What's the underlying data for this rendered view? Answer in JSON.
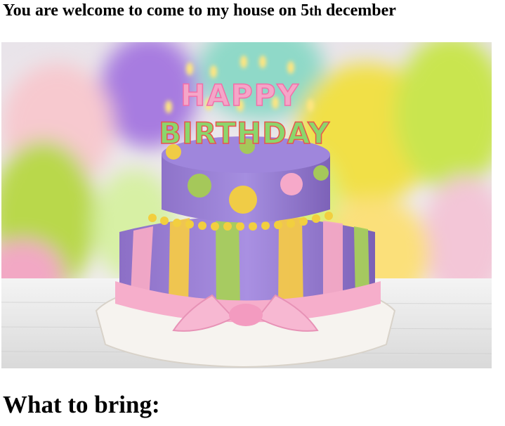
{
  "invitation": {
    "text_before": "You are welcome to come to my house on 5",
    "ordinal_suffix": "th",
    "text_after": " december"
  },
  "photo": {
    "cake_candles": {
      "word_top": "HAPPY",
      "word_bottom": "BIRTHDAY"
    }
  },
  "sections": {
    "bring_heading": "What to bring:"
  }
}
